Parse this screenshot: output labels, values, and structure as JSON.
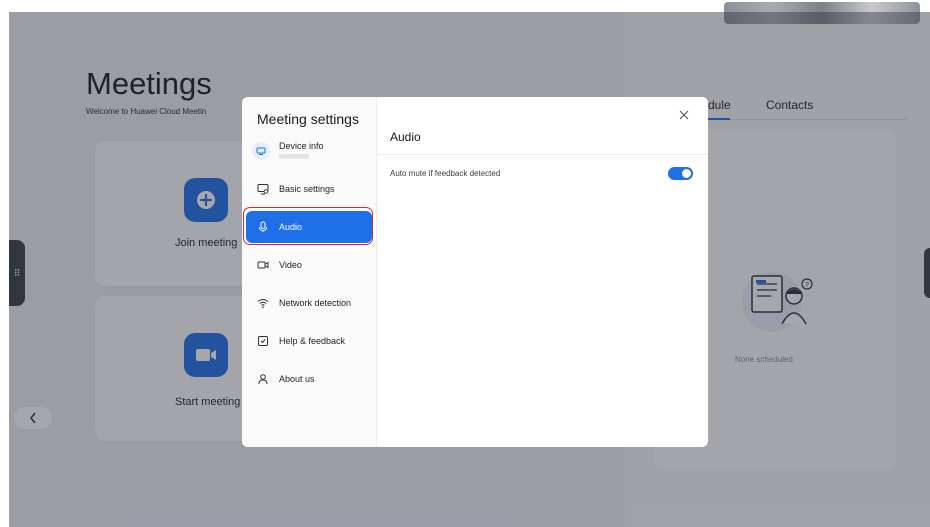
{
  "background": {
    "title": "Meetings",
    "subtitle": "Welcome to Huawei Cloud Meetin",
    "join_label": "Join meeting",
    "start_label": "Start meeting",
    "tab_schedule": "dule",
    "tab_contacts": "Contacts",
    "none_scheduled": "None scheduled"
  },
  "dialog": {
    "title": "Meeting settings",
    "device_info": "Device info",
    "nav": [
      {
        "label": "Basic settings",
        "icon": "monitor-settings-icon"
      },
      {
        "label": "Audio",
        "icon": "microphone-icon",
        "active": true
      },
      {
        "label": "Video",
        "icon": "camera-icon"
      },
      {
        "label": "Network detection",
        "icon": "wifi-icon"
      },
      {
        "label": "Help & feedback",
        "icon": "feedback-icon"
      },
      {
        "label": "About us",
        "icon": "user-icon"
      }
    ],
    "section_title": "Audio",
    "settings": [
      {
        "label": "Auto mute if feedback detected",
        "enabled": true
      }
    ]
  },
  "colors": {
    "accent": "#1f6fe8",
    "highlight_ring": "#d12d2d",
    "overlay": "#282e3a"
  }
}
